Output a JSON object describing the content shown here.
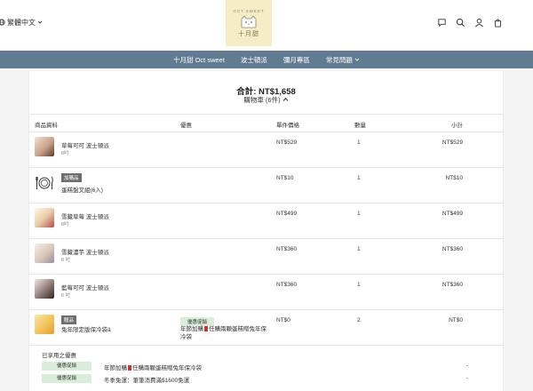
{
  "header": {
    "language": "繁體中文",
    "logo": {
      "arc_text": "OCT.SWEET",
      "name": "十月甜"
    },
    "icons": [
      "chat-icon",
      "search-icon",
      "user-icon",
      "cart-icon"
    ]
  },
  "nav": {
    "items": [
      {
        "label": "十月甜 Oct sweet"
      },
      {
        "label": "波士頓派"
      },
      {
        "label": "彌月專區"
      },
      {
        "label": "常見問題"
      }
    ]
  },
  "summary": {
    "total": "合計: NT$1,658",
    "cart_label": "購物車 (6件)"
  },
  "table": {
    "headers": [
      "商品資料",
      "優惠",
      "單件價格",
      "數量",
      "小計"
    ],
    "rows": [
      {
        "name": "草莓可可 波士頓派",
        "sub": "8吋",
        "price": "NT$529",
        "qty": "1",
        "total": "NT$529",
        "tag": "",
        "promo_badge": "",
        "promo_text": "",
        "thumb_color": "#c9a08a"
      },
      {
        "name": "蛋糕盤叉組(6入)",
        "sub": "",
        "price": "NT$10",
        "qty": "1",
        "total": "NT$10",
        "tag": "加購品",
        "promo_badge": "",
        "promo_text": "",
        "thumb_color": ""
      },
      {
        "name": "雪藏草莓 波士頓派",
        "sub": "8吋",
        "price": "NT$499",
        "qty": "1",
        "total": "NT$499",
        "tag": "",
        "promo_badge": "",
        "promo_text": "",
        "thumb_color": "#e8cfa8"
      },
      {
        "name": "雪藏濃芋 波士頓派",
        "sub": "8 吋",
        "price": "NT$360",
        "qty": "1",
        "total": "NT$360",
        "tag": "",
        "promo_badge": "",
        "promo_text": "",
        "thumb_color": "#d9c7b8"
      },
      {
        "name": "藍莓可可 波士頓派",
        "sub": "6 吋",
        "price": "NT$360",
        "qty": "1",
        "total": "NT$360",
        "tag": "",
        "promo_badge": "",
        "promo_text": "",
        "thumb_color": "#8f7a74"
      },
      {
        "name": "兔年限定版保冷袋ä",
        "sub": "",
        "price": "NT$0",
        "qty": "2",
        "total": "NT$0",
        "tag": "贈品",
        "promo_badge": "優惠促銷",
        "promo_text_a": "年節加購",
        "promo_text_b": "任購兩顆蛋糕贈兔年保冷袋",
        "thumb_color": "#f2c35a"
      }
    ]
  },
  "used_promotions": {
    "title": "已享用之優惠",
    "items": [
      {
        "badge": "優惠促銷",
        "text_a": "年節加購",
        "text_b": "任購兩顆蛋糕贈兔年保冷袋",
        "discount": "-"
      },
      {
        "badge": "優惠促銷",
        "text_a": "冬季免運：筆筆消費滿$1600免運",
        "text_b": "",
        "discount": "-"
      }
    ]
  },
  "colors": {
    "nav_bg": "#607b92",
    "logo_bg": "#f6ecc6",
    "promo_green": "#d9eed9",
    "tag_gray": "#6d6d6d",
    "red_mark": "#cc3333"
  }
}
